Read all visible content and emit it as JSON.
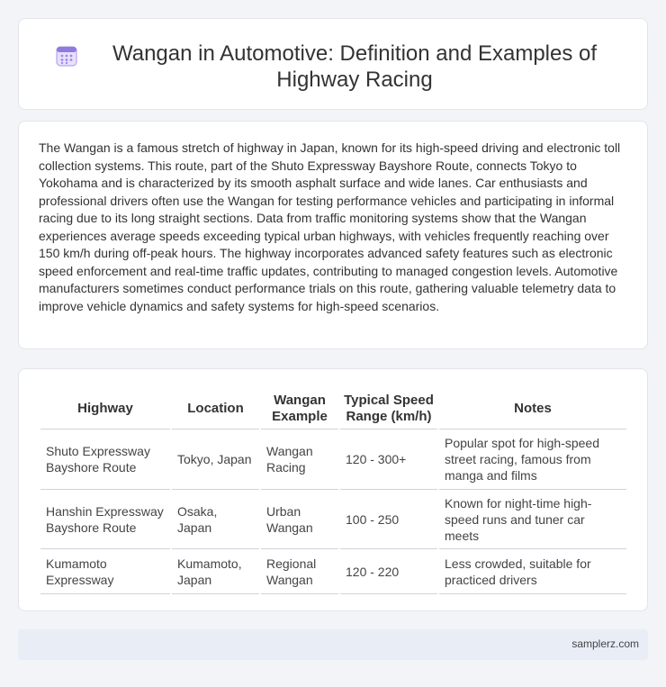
{
  "header": {
    "icon": "calendar-icon",
    "title": "Wangan in Automotive: Definition and Examples of Highway Racing"
  },
  "intro": {
    "text": "The Wangan is a famous stretch of highway in Japan, known for its high-speed driving and electronic toll collection systems. This route, part of the Shuto Expressway Bayshore Route, connects Tokyo to Yokohama and is characterized by its smooth asphalt surface and wide lanes. Car enthusiasts and professional drivers often use the Wangan for testing performance vehicles and participating in informal racing due to its long straight sections. Data from traffic monitoring systems show that the Wangan experiences average speeds exceeding typical urban highways, with vehicles frequently reaching over 150 km/h during off-peak hours. The highway incorporates advanced safety features such as electronic speed enforcement and real-time traffic updates, contributing to managed congestion levels. Automotive manufacturers sometimes conduct performance trials on this route, gathering valuable telemetry data to improve vehicle dynamics and safety systems for high-speed scenarios."
  },
  "table": {
    "headers": [
      "Highway",
      "Location",
      "Wangan Example",
      "Typical Speed Range (km/h)",
      "Notes"
    ],
    "rows": [
      [
        "Shuto Expressway Bayshore Route",
        "Tokyo, Japan",
        "Wangan Racing",
        "120 - 300+",
        "Popular spot for high-speed street racing, famous from manga and films"
      ],
      [
        "Hanshin Expressway Bayshore Route",
        "Osaka, Japan",
        "Urban Wangan",
        "100 - 250",
        "Known for night-time high-speed runs and tuner car meets"
      ],
      [
        "Kumamoto Expressway",
        "Kumamoto, Japan",
        "Regional Wangan",
        "120 - 220",
        "Less crowded, suitable for practiced drivers"
      ]
    ]
  },
  "footer": {
    "site": "samplerz.com"
  },
  "colors": {
    "page_bg": "#f2f4f8",
    "footer_bg": "#e8edf6",
    "icon_accent": "#8f7be0"
  }
}
